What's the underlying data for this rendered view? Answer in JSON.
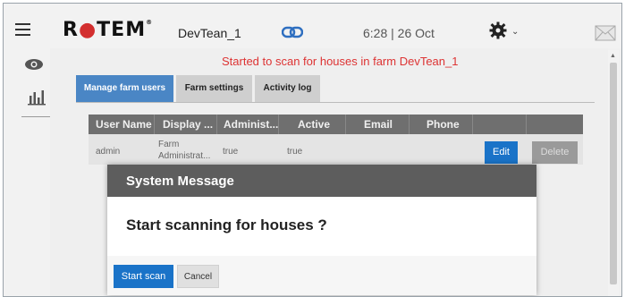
{
  "header": {
    "logo": "ROTEM",
    "farm_name": "DevTean_1",
    "time": "6:28",
    "date": "26 Oct"
  },
  "status_message": "Started to scan for houses in farm DevTean_1",
  "tabs": [
    {
      "label": "Manage farm users",
      "active": true
    },
    {
      "label": "Farm settings",
      "active": false
    },
    {
      "label": "Activity log",
      "active": false
    }
  ],
  "table": {
    "columns": [
      "User Name",
      "Display ...",
      "Administ...",
      "Active",
      "Email",
      "Phone"
    ],
    "rows": [
      {
        "user_name": "admin",
        "display_line1": "Farm",
        "display_line2": "Administrat...",
        "admin": "true",
        "active": "true",
        "email": "",
        "phone": ""
      }
    ],
    "edit_label": "Edit",
    "delete_label": "Delete"
  },
  "modal": {
    "title": "System Message",
    "body": "Start scanning for houses ?",
    "primary_label": "Start scan",
    "secondary_label": "Cancel"
  },
  "colors": {
    "accent": "#1a73c8",
    "tab_active": "#4a86c5",
    "status_text": "#dd3333",
    "logo_o": "#d32f2f"
  },
  "icons": [
    "menu-icon",
    "link-icon",
    "gear-icon",
    "mail-icon",
    "eye-icon",
    "bar-chart-icon"
  ]
}
